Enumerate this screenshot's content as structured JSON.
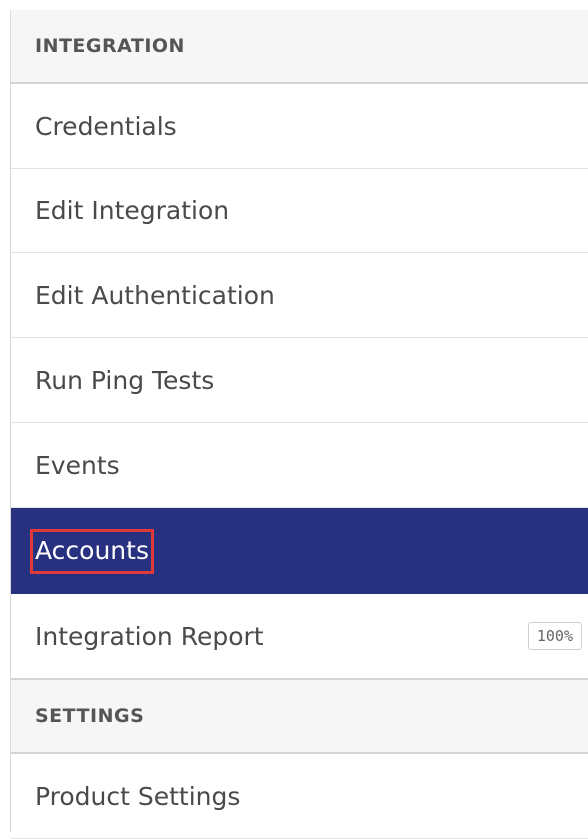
{
  "integration_section": {
    "header": "INTEGRATION",
    "items": [
      {
        "label": "Credentials"
      },
      {
        "label": "Edit Integration"
      },
      {
        "label": "Edit Authentication"
      },
      {
        "label": "Run Ping Tests"
      },
      {
        "label": "Events"
      },
      {
        "label": "Accounts",
        "active": true
      },
      {
        "label": "Integration Report",
        "badge": "100%"
      }
    ]
  },
  "settings_section": {
    "header": "SETTINGS",
    "items": [
      {
        "label": "Product Settings"
      }
    ]
  },
  "colors": {
    "active_bg": "#283080",
    "highlight_outline": "#e0393a"
  }
}
